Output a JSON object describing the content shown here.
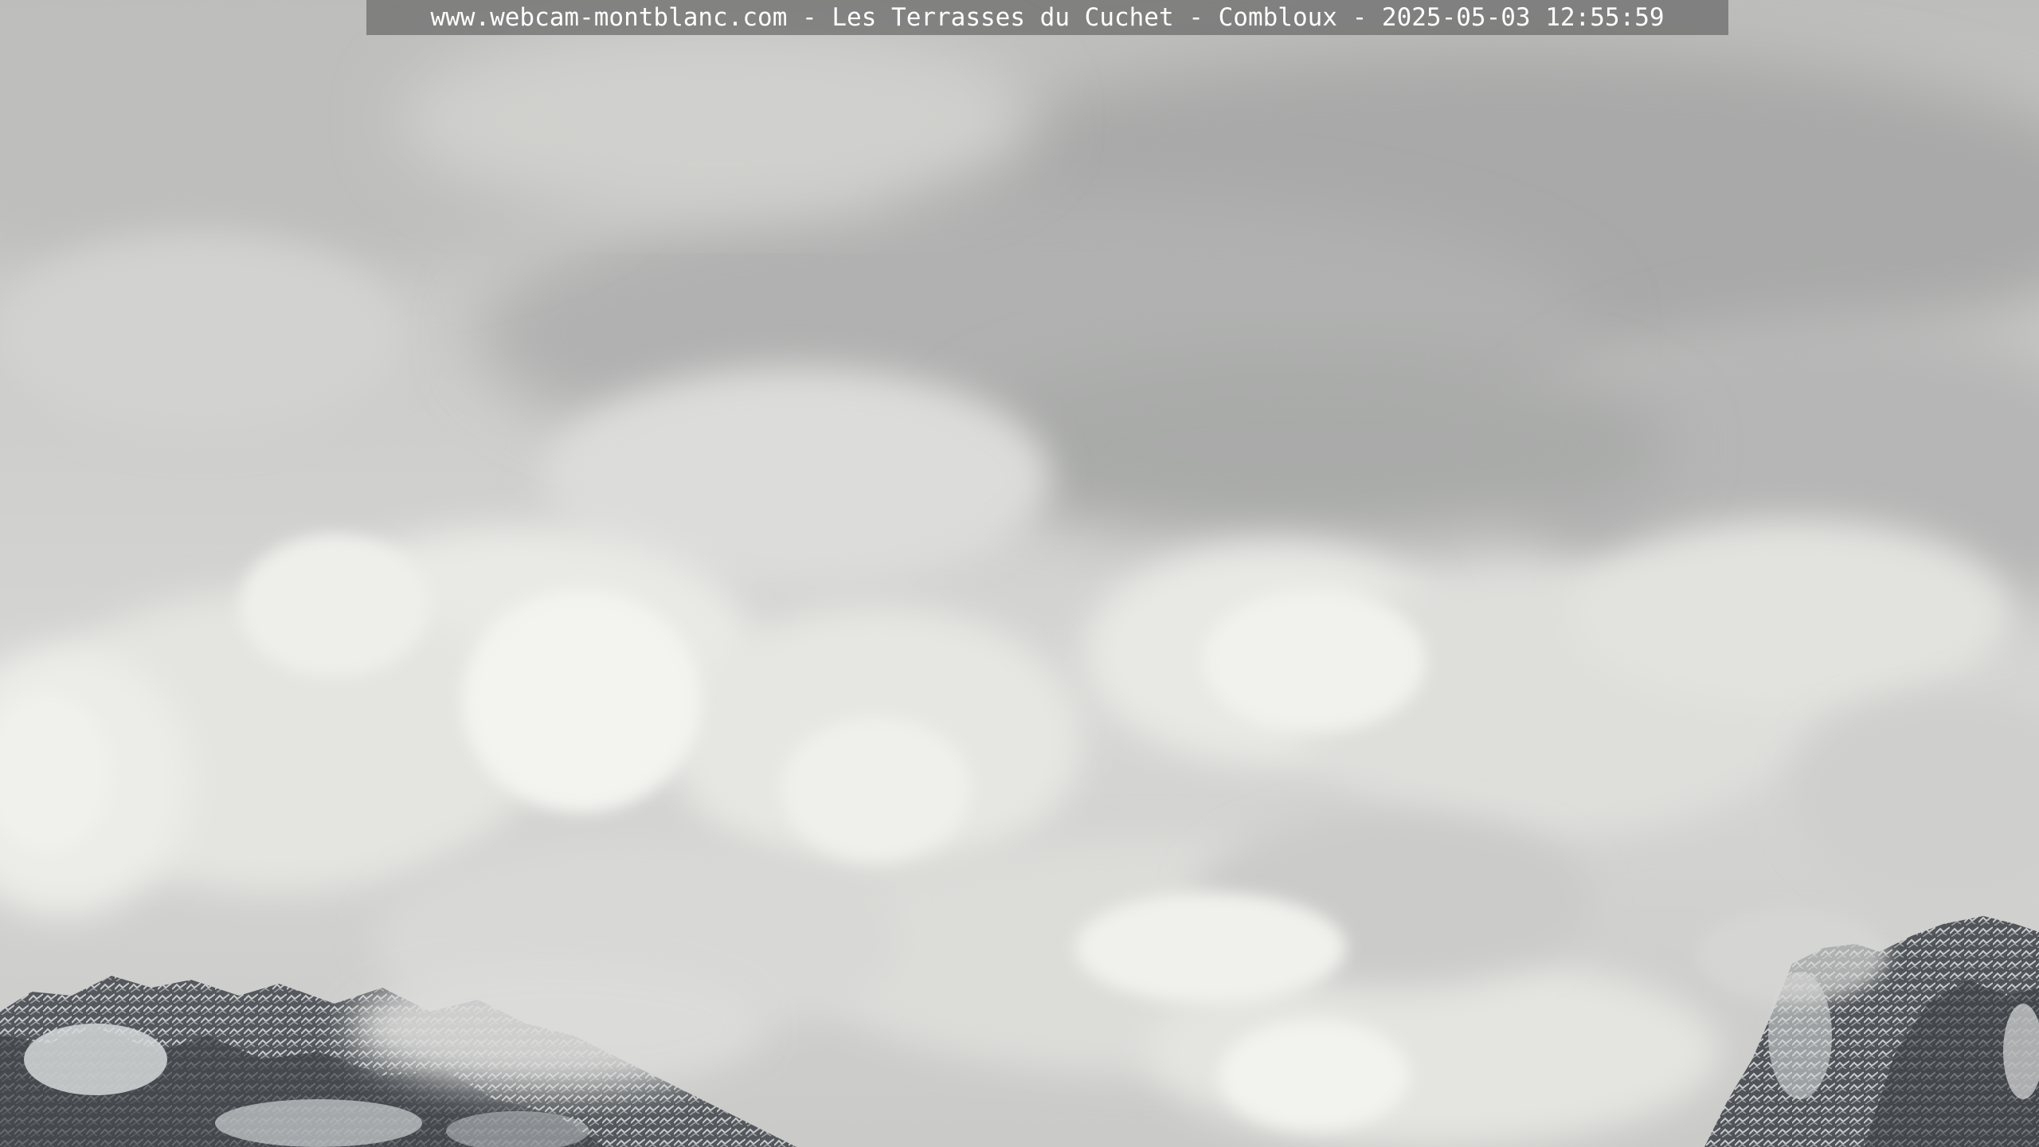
{
  "webcam": {
    "overlay_caption": "www.webcam-montblanc.com - Les Terrasses du Cuchet - Combloux - 2025-05-03 12:55:59"
  },
  "scene": {
    "description_icon": "cloudy-mountain-webcam-image",
    "colors": {
      "sky_dark": "#a9aaa9",
      "cloud_light": "#eeeeeb",
      "rock_dark": "#3e4247",
      "snow": "#d8dadb"
    }
  }
}
